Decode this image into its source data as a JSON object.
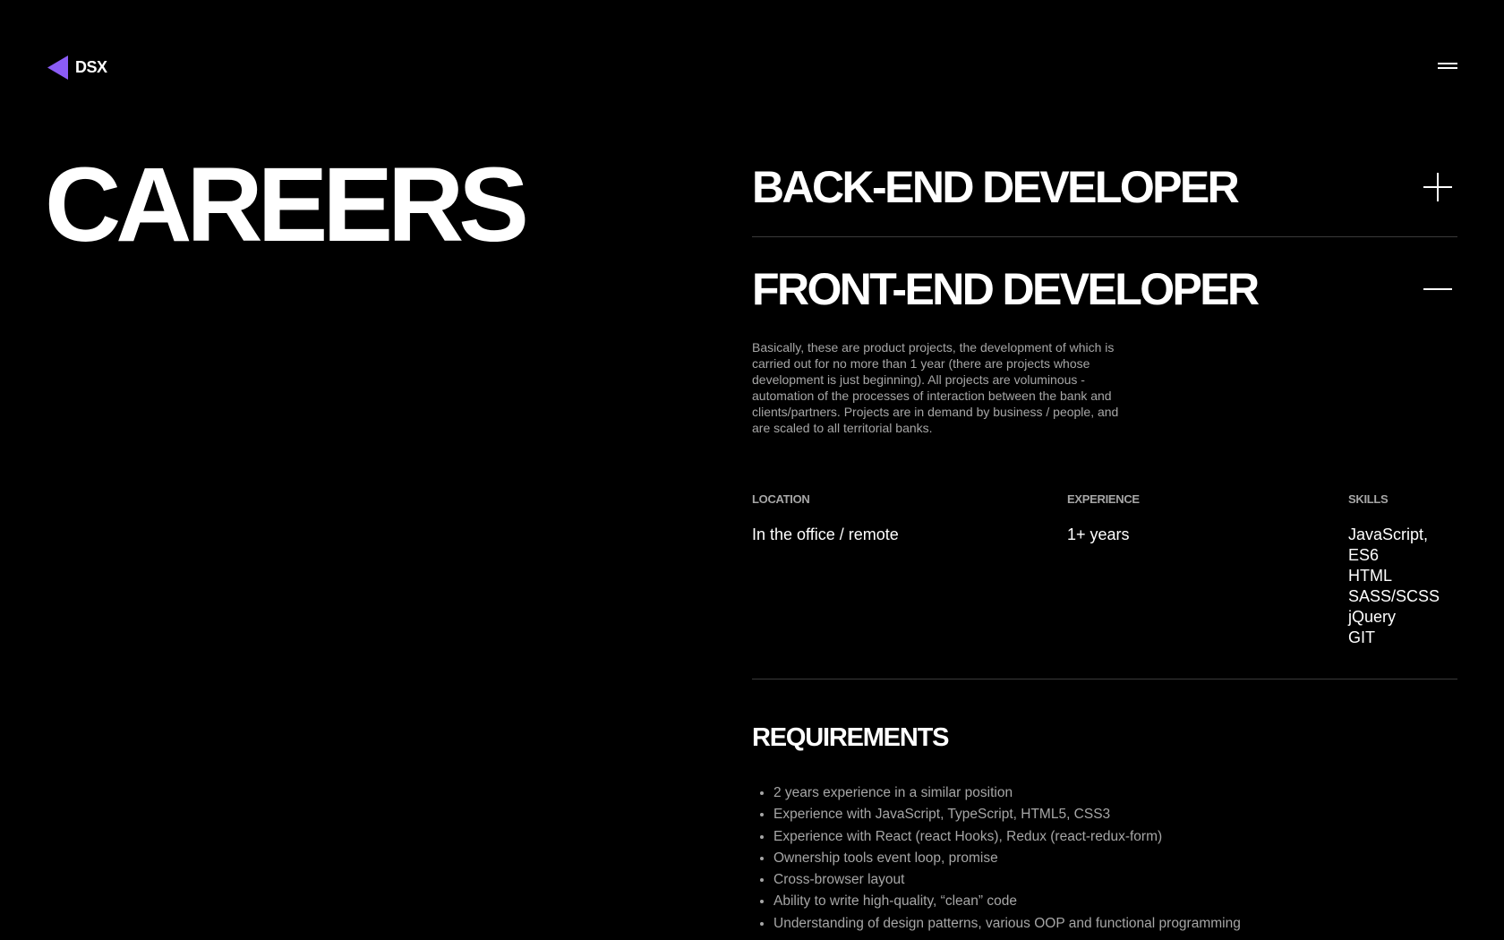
{
  "brand": {
    "name": "DSX",
    "accent": "#8b5cf6"
  },
  "header": {
    "menu_icon": "hamburger-menu-icon"
  },
  "page": {
    "title": "CAREERS"
  },
  "jobs": [
    {
      "title": "BACK-END DEVELOPER",
      "expanded": false,
      "toggle_icon": "plus-icon"
    },
    {
      "title": "FRONT-END DEVELOPER",
      "expanded": true,
      "toggle_icon": "minus-icon",
      "description": "Basically, these are product projects, the development of which is carried out for no more than 1 year (there are projects whose development is just beginning). All projects are voluminous - automation of the processes of interaction between the bank and clients/partners. Projects are in demand by business / people, and are scaled to all territorial banks.",
      "location_label": "LOCATION",
      "location": "In the office / remote",
      "experience_label": "EXPERIENCE",
      "experience": "1+ years",
      "skills_label": "SKILLS",
      "skills": [
        "JavaScript, ES6",
        "HTML",
        "SASS/SCSS",
        "jQuery",
        "GIT"
      ],
      "requirements_title": "REQUIREMENTS",
      "requirements": [
        "2 years experience in a similar position",
        "Experience with JavaScript, TypeScript, HTML5, CSS3",
        "Experience with React (react Hooks), Redux (react-redux-form)",
        "Ownership tools event loop, promise",
        "Cross-browser layout",
        "Ability to write high-quality, “clean” code",
        "Understanding of design patterns, various OOP and functional programming"
      ]
    }
  ]
}
